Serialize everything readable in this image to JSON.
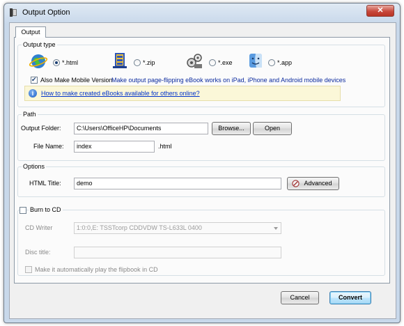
{
  "window": {
    "title": "Output Option",
    "close_glyph": "✕"
  },
  "tabs": [
    {
      "label": "Output"
    }
  ],
  "output_type": {
    "group_title": "Output type",
    "options": [
      {
        "label": "*.html",
        "icon": "globe-icon",
        "checked": true
      },
      {
        "label": "*.zip",
        "icon": "zip-archive-icon",
        "checked": false
      },
      {
        "label": "*.exe",
        "icon": "exe-gears-icon",
        "checked": false
      },
      {
        "label": "*.app",
        "icon": "mac-finder-icon",
        "checked": false
      }
    ],
    "mobile": {
      "label": "Also Make Mobile Version",
      "checked": true,
      "note": "Make output page-flipping eBook works on iPad, iPhone and Android mobile devices"
    },
    "tip": {
      "icon": "info-icon",
      "link": "How to make created eBooks available for others online?"
    }
  },
  "path": {
    "group_title": "Path",
    "output_folder_label": "Output Folder:",
    "output_folder_value": "C:\\Users\\OfficeHP\\Documents",
    "browse_label": "Browse...",
    "open_label": "Open",
    "file_name_label": "File Name:",
    "file_name_value": "index",
    "extension": ".html"
  },
  "options": {
    "group_title": "Options",
    "html_title_label": "HTML Title:",
    "html_title_value": "demo",
    "advanced_label": "Advanced"
  },
  "burn": {
    "label": "Burn to CD",
    "checked": false,
    "cd_writer_label": "CD Writer",
    "cd_writer_value": "1:0:0,E: TSSTcorp CDDVDW TS-L633L  0400",
    "disc_title_label": "Disc title:",
    "disc_title_value": "",
    "autoplay_label": "Make it automatically play the flipbook in CD"
  },
  "footer": {
    "cancel_label": "Cancel",
    "convert_label": "Convert"
  }
}
